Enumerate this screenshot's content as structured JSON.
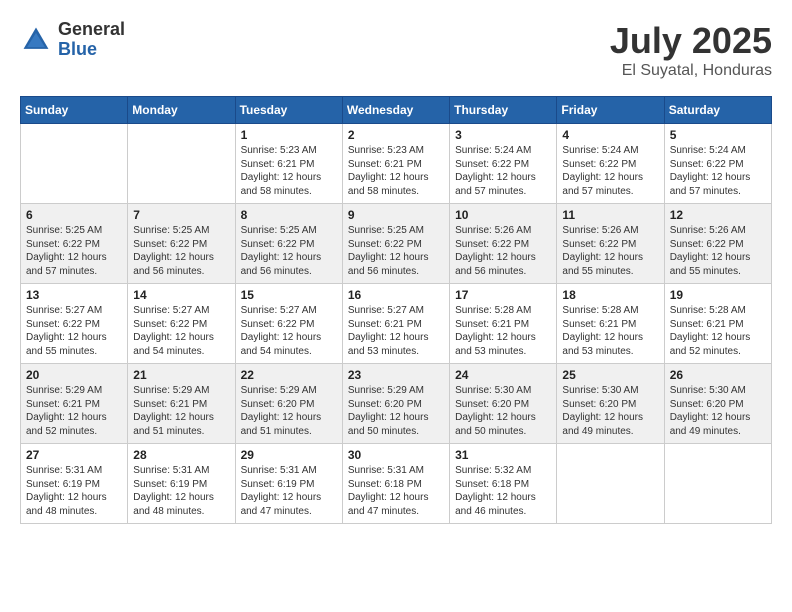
{
  "header": {
    "logo_general": "General",
    "logo_blue": "Blue",
    "month_title": "July 2025",
    "location": "El Suyatal, Honduras"
  },
  "days_of_week": [
    "Sunday",
    "Monday",
    "Tuesday",
    "Wednesday",
    "Thursday",
    "Friday",
    "Saturday"
  ],
  "weeks": [
    [
      {
        "day": "",
        "sunrise": "",
        "sunset": "",
        "daylight": ""
      },
      {
        "day": "",
        "sunrise": "",
        "sunset": "",
        "daylight": ""
      },
      {
        "day": "1",
        "sunrise": "Sunrise: 5:23 AM",
        "sunset": "Sunset: 6:21 PM",
        "daylight": "Daylight: 12 hours and 58 minutes."
      },
      {
        "day": "2",
        "sunrise": "Sunrise: 5:23 AM",
        "sunset": "Sunset: 6:21 PM",
        "daylight": "Daylight: 12 hours and 58 minutes."
      },
      {
        "day": "3",
        "sunrise": "Sunrise: 5:24 AM",
        "sunset": "Sunset: 6:22 PM",
        "daylight": "Daylight: 12 hours and 57 minutes."
      },
      {
        "day": "4",
        "sunrise": "Sunrise: 5:24 AM",
        "sunset": "Sunset: 6:22 PM",
        "daylight": "Daylight: 12 hours and 57 minutes."
      },
      {
        "day": "5",
        "sunrise": "Sunrise: 5:24 AM",
        "sunset": "Sunset: 6:22 PM",
        "daylight": "Daylight: 12 hours and 57 minutes."
      }
    ],
    [
      {
        "day": "6",
        "sunrise": "Sunrise: 5:25 AM",
        "sunset": "Sunset: 6:22 PM",
        "daylight": "Daylight: 12 hours and 57 minutes."
      },
      {
        "day": "7",
        "sunrise": "Sunrise: 5:25 AM",
        "sunset": "Sunset: 6:22 PM",
        "daylight": "Daylight: 12 hours and 56 minutes."
      },
      {
        "day": "8",
        "sunrise": "Sunrise: 5:25 AM",
        "sunset": "Sunset: 6:22 PM",
        "daylight": "Daylight: 12 hours and 56 minutes."
      },
      {
        "day": "9",
        "sunrise": "Sunrise: 5:25 AM",
        "sunset": "Sunset: 6:22 PM",
        "daylight": "Daylight: 12 hours and 56 minutes."
      },
      {
        "day": "10",
        "sunrise": "Sunrise: 5:26 AM",
        "sunset": "Sunset: 6:22 PM",
        "daylight": "Daylight: 12 hours and 56 minutes."
      },
      {
        "day": "11",
        "sunrise": "Sunrise: 5:26 AM",
        "sunset": "Sunset: 6:22 PM",
        "daylight": "Daylight: 12 hours and 55 minutes."
      },
      {
        "day": "12",
        "sunrise": "Sunrise: 5:26 AM",
        "sunset": "Sunset: 6:22 PM",
        "daylight": "Daylight: 12 hours and 55 minutes."
      }
    ],
    [
      {
        "day": "13",
        "sunrise": "Sunrise: 5:27 AM",
        "sunset": "Sunset: 6:22 PM",
        "daylight": "Daylight: 12 hours and 55 minutes."
      },
      {
        "day": "14",
        "sunrise": "Sunrise: 5:27 AM",
        "sunset": "Sunset: 6:22 PM",
        "daylight": "Daylight: 12 hours and 54 minutes."
      },
      {
        "day": "15",
        "sunrise": "Sunrise: 5:27 AM",
        "sunset": "Sunset: 6:22 PM",
        "daylight": "Daylight: 12 hours and 54 minutes."
      },
      {
        "day": "16",
        "sunrise": "Sunrise: 5:27 AM",
        "sunset": "Sunset: 6:21 PM",
        "daylight": "Daylight: 12 hours and 53 minutes."
      },
      {
        "day": "17",
        "sunrise": "Sunrise: 5:28 AM",
        "sunset": "Sunset: 6:21 PM",
        "daylight": "Daylight: 12 hours and 53 minutes."
      },
      {
        "day": "18",
        "sunrise": "Sunrise: 5:28 AM",
        "sunset": "Sunset: 6:21 PM",
        "daylight": "Daylight: 12 hours and 53 minutes."
      },
      {
        "day": "19",
        "sunrise": "Sunrise: 5:28 AM",
        "sunset": "Sunset: 6:21 PM",
        "daylight": "Daylight: 12 hours and 52 minutes."
      }
    ],
    [
      {
        "day": "20",
        "sunrise": "Sunrise: 5:29 AM",
        "sunset": "Sunset: 6:21 PM",
        "daylight": "Daylight: 12 hours and 52 minutes."
      },
      {
        "day": "21",
        "sunrise": "Sunrise: 5:29 AM",
        "sunset": "Sunset: 6:21 PM",
        "daylight": "Daylight: 12 hours and 51 minutes."
      },
      {
        "day": "22",
        "sunrise": "Sunrise: 5:29 AM",
        "sunset": "Sunset: 6:20 PM",
        "daylight": "Daylight: 12 hours and 51 minutes."
      },
      {
        "day": "23",
        "sunrise": "Sunrise: 5:29 AM",
        "sunset": "Sunset: 6:20 PM",
        "daylight": "Daylight: 12 hours and 50 minutes."
      },
      {
        "day": "24",
        "sunrise": "Sunrise: 5:30 AM",
        "sunset": "Sunset: 6:20 PM",
        "daylight": "Daylight: 12 hours and 50 minutes."
      },
      {
        "day": "25",
        "sunrise": "Sunrise: 5:30 AM",
        "sunset": "Sunset: 6:20 PM",
        "daylight": "Daylight: 12 hours and 49 minutes."
      },
      {
        "day": "26",
        "sunrise": "Sunrise: 5:30 AM",
        "sunset": "Sunset: 6:20 PM",
        "daylight": "Daylight: 12 hours and 49 minutes."
      }
    ],
    [
      {
        "day": "27",
        "sunrise": "Sunrise: 5:31 AM",
        "sunset": "Sunset: 6:19 PM",
        "daylight": "Daylight: 12 hours and 48 minutes."
      },
      {
        "day": "28",
        "sunrise": "Sunrise: 5:31 AM",
        "sunset": "Sunset: 6:19 PM",
        "daylight": "Daylight: 12 hours and 48 minutes."
      },
      {
        "day": "29",
        "sunrise": "Sunrise: 5:31 AM",
        "sunset": "Sunset: 6:19 PM",
        "daylight": "Daylight: 12 hours and 47 minutes."
      },
      {
        "day": "30",
        "sunrise": "Sunrise: 5:31 AM",
        "sunset": "Sunset: 6:18 PM",
        "daylight": "Daylight: 12 hours and 47 minutes."
      },
      {
        "day": "31",
        "sunrise": "Sunrise: 5:32 AM",
        "sunset": "Sunset: 6:18 PM",
        "daylight": "Daylight: 12 hours and 46 minutes."
      },
      {
        "day": "",
        "sunrise": "",
        "sunset": "",
        "daylight": ""
      },
      {
        "day": "",
        "sunrise": "",
        "sunset": "",
        "daylight": ""
      }
    ]
  ]
}
